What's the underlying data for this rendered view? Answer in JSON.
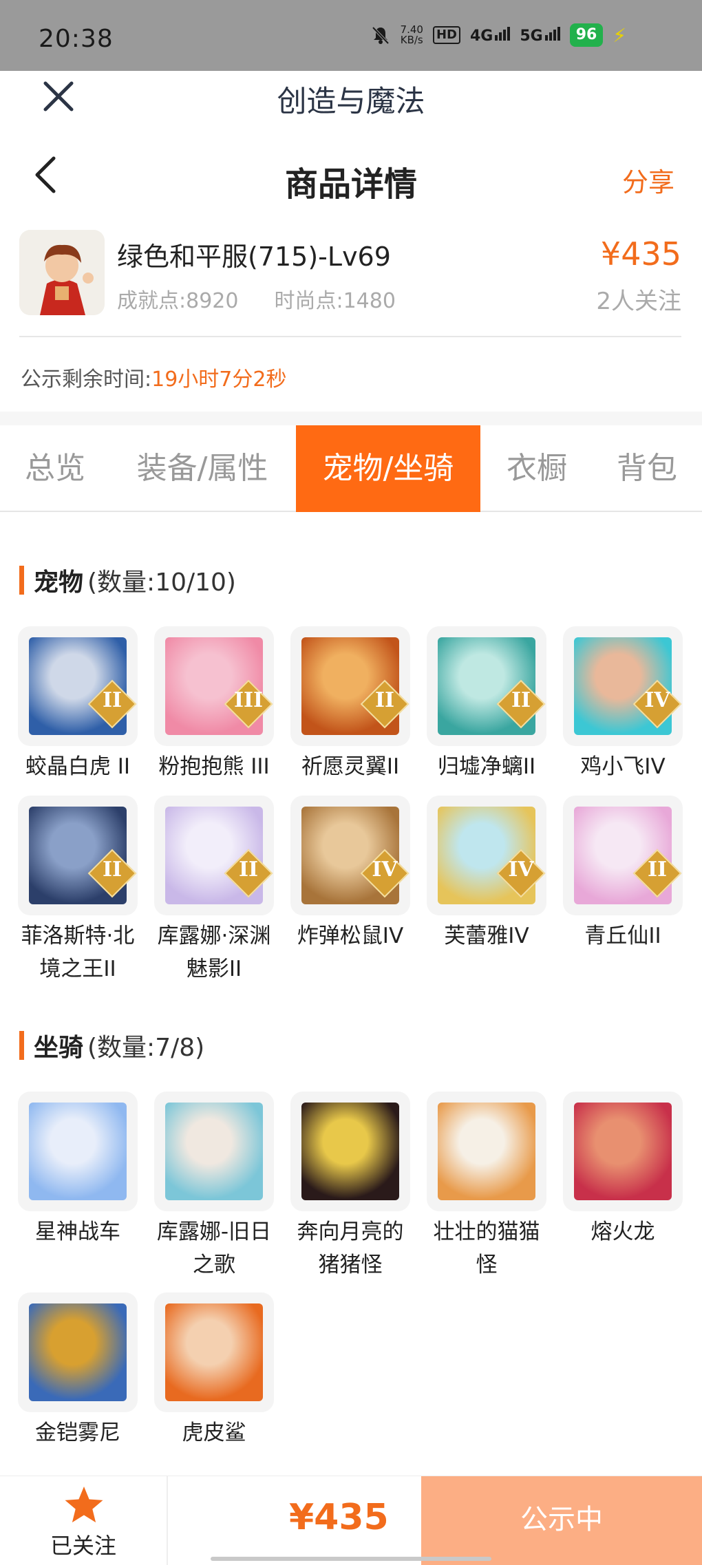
{
  "status_bar": {
    "time": "20:38",
    "net_speed_value": "7.40",
    "net_speed_unit": "KB/s",
    "hd_badge": "HD",
    "net_4g": "4G",
    "net_5g": "5G",
    "battery": "96"
  },
  "mini_header": {
    "title": "创造与魔法"
  },
  "nav": {
    "title": "商品详情",
    "share": "分享"
  },
  "product": {
    "name": "绿色和平服(715)-Lv69",
    "achievement": "成就点:8920",
    "fashion": "时尚点:1480",
    "price": "¥435",
    "watchers": "2人关注"
  },
  "countdown": {
    "label": "公示剩余时间:",
    "value": "19小时7分2秒"
  },
  "tabs": [
    {
      "label": "总览"
    },
    {
      "label": "装备/属性"
    },
    {
      "label": "宠物/坐骑"
    },
    {
      "label": "衣橱"
    },
    {
      "label": "背包"
    }
  ],
  "pets": {
    "title": "宠物",
    "count": "(数量:10/10)",
    "items": [
      {
        "name": "蛟晶白虎 II",
        "rank": "II",
        "color_a": "#2f5fa8",
        "color_b": "#cfd8e8"
      },
      {
        "name": "粉抱抱熊 III",
        "rank": "III",
        "color_a": "#f08aa6",
        "color_b": "#f6c1d0"
      },
      {
        "name": "祈愿灵翼II",
        "rank": "II",
        "color_a": "#c2541a",
        "color_b": "#f0b060"
      },
      {
        "name": "归墟净螭II",
        "rank": "II",
        "color_a": "#3aa6a0",
        "color_b": "#bfe8e2"
      },
      {
        "name": "鸡小飞IV",
        "rank": "IV",
        "color_a": "#3cc7d4",
        "color_b": "#e9b89a"
      },
      {
        "name": "菲洛斯特·北境之王II",
        "rank": "II",
        "color_a": "#2c3f6a",
        "color_b": "#8aa0c8"
      },
      {
        "name": "库露娜·深渊魅影II",
        "rank": "II",
        "color_a": "#c9b8e8",
        "color_b": "#f2eefa"
      },
      {
        "name": "炸弹松鼠IV",
        "rank": "IV",
        "color_a": "#a8743a",
        "color_b": "#e8c89a"
      },
      {
        "name": "芙蕾雅IV",
        "rank": "IV",
        "color_a": "#e6c45a",
        "color_b": "#bfe6ee"
      },
      {
        "name": "青丘仙II",
        "rank": "II",
        "color_a": "#e8a8d8",
        "color_b": "#f6e8f4"
      }
    ]
  },
  "mounts": {
    "title": "坐骑",
    "count": "(数量:7/8)",
    "items": [
      {
        "name": "星神战车",
        "color_a": "#8fb8f0",
        "color_b": "#e8eefa"
      },
      {
        "name": "库露娜-旧日之歌",
        "color_a": "#7cc6d8",
        "color_b": "#f0e8e0"
      },
      {
        "name": "奔向月亮的猪猪怪",
        "color_a": "#2a1a1a",
        "color_b": "#e8c84a"
      },
      {
        "name": "壮壮的猫猫怪",
        "color_a": "#e89a4a",
        "color_b": "#f6f0e6"
      },
      {
        "name": "熔火龙",
        "color_a": "#c8304a",
        "color_b": "#e89070"
      },
      {
        "name": "金铠雾尼",
        "color_a": "#3a6ab8",
        "color_b": "#d8a030"
      },
      {
        "name": "虎皮鲨",
        "color_a": "#e86a20",
        "color_b": "#f4d0b0"
      }
    ]
  },
  "bottom_bar": {
    "follow_label": "已关注",
    "price": "¥435",
    "status_label": "公示中"
  },
  "colors": {
    "accent": "#f26c1c",
    "tab_active": "#ff6a13",
    "status_button": "#fcae84"
  }
}
